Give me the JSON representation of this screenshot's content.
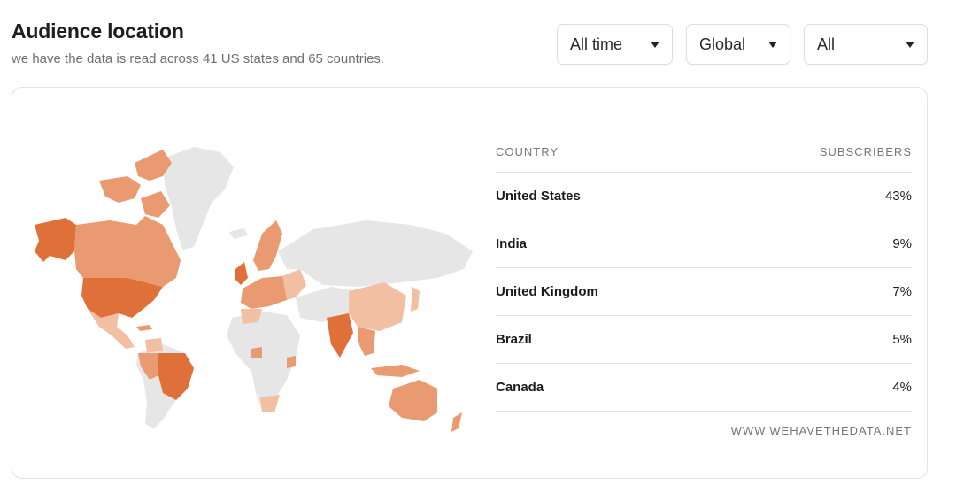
{
  "header": {
    "title": "Audience location",
    "subtitle": "we have the data is read across 41 US states and 65 countries."
  },
  "filters": [
    {
      "label": "All time"
    },
    {
      "label": "Global"
    },
    {
      "label": "All"
    }
  ],
  "table": {
    "columns": [
      "COUNTRY",
      "SUBSCRIBERS"
    ],
    "rows": [
      {
        "country": "United States",
        "subscribers": "43%"
      },
      {
        "country": "India",
        "subscribers": "9%"
      },
      {
        "country": "United Kingdom",
        "subscribers": "7%"
      },
      {
        "country": "Brazil",
        "subscribers": "5%"
      },
      {
        "country": "Canada",
        "subscribers": "4%"
      }
    ]
  },
  "footer": {
    "source": "WWW.WEHAVETHEDATA.NET"
  },
  "colors": {
    "map_base": "#e6e6e6",
    "heat_high": "#e0703a",
    "heat_mid": "#ea9a70",
    "heat_low": "#f2bfa2",
    "heat_faint": "#f6d6c3"
  }
}
